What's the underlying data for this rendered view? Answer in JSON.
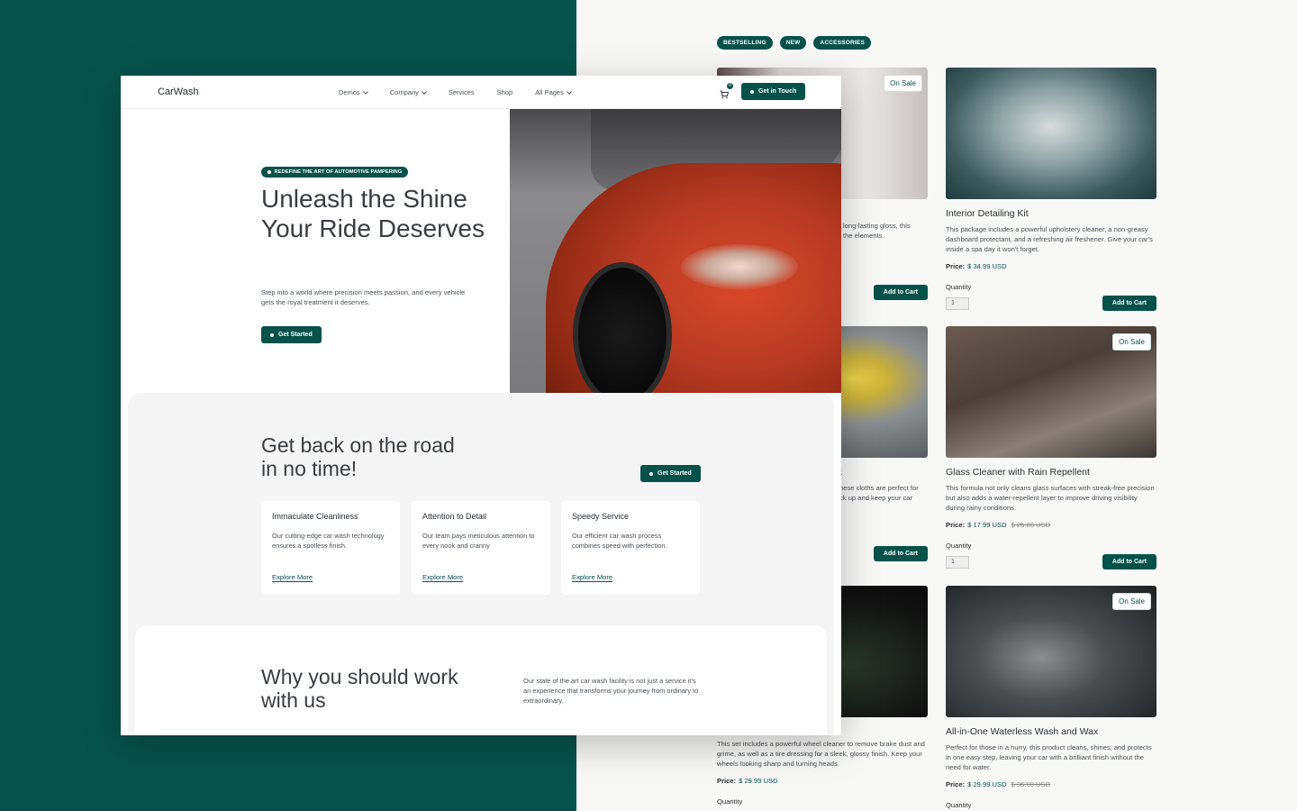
{
  "shop": {
    "filters": [
      "BESTSELLING",
      "NEW",
      "ACCESSORIES"
    ],
    "sale_badge": "On Sale",
    "price_label": "Price:",
    "quantity_label": "Quantity",
    "quantity_value": "1",
    "add_to_cart": "Add to Cart",
    "products": [
      {
        "title": "",
        "desc": "long-lasting gloss, this\nthe elements.",
        "price": "",
        "old_price": "",
        "on_sale": true
      },
      {
        "title": "Interior Detailing Kit",
        "desc": "This package includes a powerful upholstery cleaner, a non-greasy dashboard protectant, and a refreshing air freshener. Give your car's inside a spa day it won't forget.",
        "price": "$ 34.99 USD",
        "old_price": "",
        "on_sale": false
      },
      {
        "title": "t",
        "desc": "hese cloths are perfect for\nck up and keep your car",
        "price": "",
        "old_price": "",
        "on_sale": false
      },
      {
        "title": "Glass Cleaner with Rain Repellent",
        "desc": "This formula not only cleans glass surfaces with streak-free precision but also adds a water-repellent layer to improve driving visibility during rainy conditions.",
        "price": "$ 17.99 USD",
        "old_price": "$ 25.00 USD",
        "on_sale": true
      },
      {
        "title": "",
        "desc": "This set includes a powerful wheel cleaner to remove brake dust and grime, as well as a tire dressing for a sleek, glossy finish. Keep your wheels looking sharp and turning heads.",
        "price": "$ 29.99 USD",
        "old_price": "",
        "on_sale": false
      },
      {
        "title": "All-in-One Waterless Wash and Wax",
        "desc": "Perfect for those in a hurry, this product cleans, shines, and protects in one easy step, leaving your car with a brilliant finish without the need for water.",
        "price": "$ 29.99 USD",
        "old_price": "$ 35.00 USD",
        "on_sale": true
      }
    ]
  },
  "home": {
    "logo": "CarWash",
    "menu": [
      "Demos",
      "Company",
      "Services",
      "Shop",
      "All Pages"
    ],
    "cart_count": "0",
    "touch_button": "Get in Touch",
    "tagline": "REDEFINE THE ART OF AUTOMOTIVE PAMPERING",
    "hero_title": "Unleash the Shine Your Ride Deserves",
    "hero_sub": "Step into a world where precision meets passion, and every vehicle gets the royal treatment it deserves.",
    "hero_button": "Get Started",
    "s2_title": "Get back on the road in no time!",
    "s2_button": "Get Started",
    "features": [
      {
        "title": "Immaculate Cleanliness",
        "desc": "Our cutting-edge car wash technology ensures a spotless finish.",
        "link": "Explore More"
      },
      {
        "title": "Attention to Detail",
        "desc": "Our team pays meticulous attention to every nook and cranny",
        "link": "Explore More"
      },
      {
        "title": "Speedy Service",
        "desc": "Our efficient car wash process combines speed with perfection.",
        "link": "Explore More"
      }
    ],
    "s3_title": "Why you should work with us",
    "s3_text": "Our state of the art car wash facility is not just a service it's an experience that transforms your journey from ordinary to extraordinary."
  },
  "colors": {
    "brand": "#06524b",
    "background": "#f8f8f7"
  }
}
